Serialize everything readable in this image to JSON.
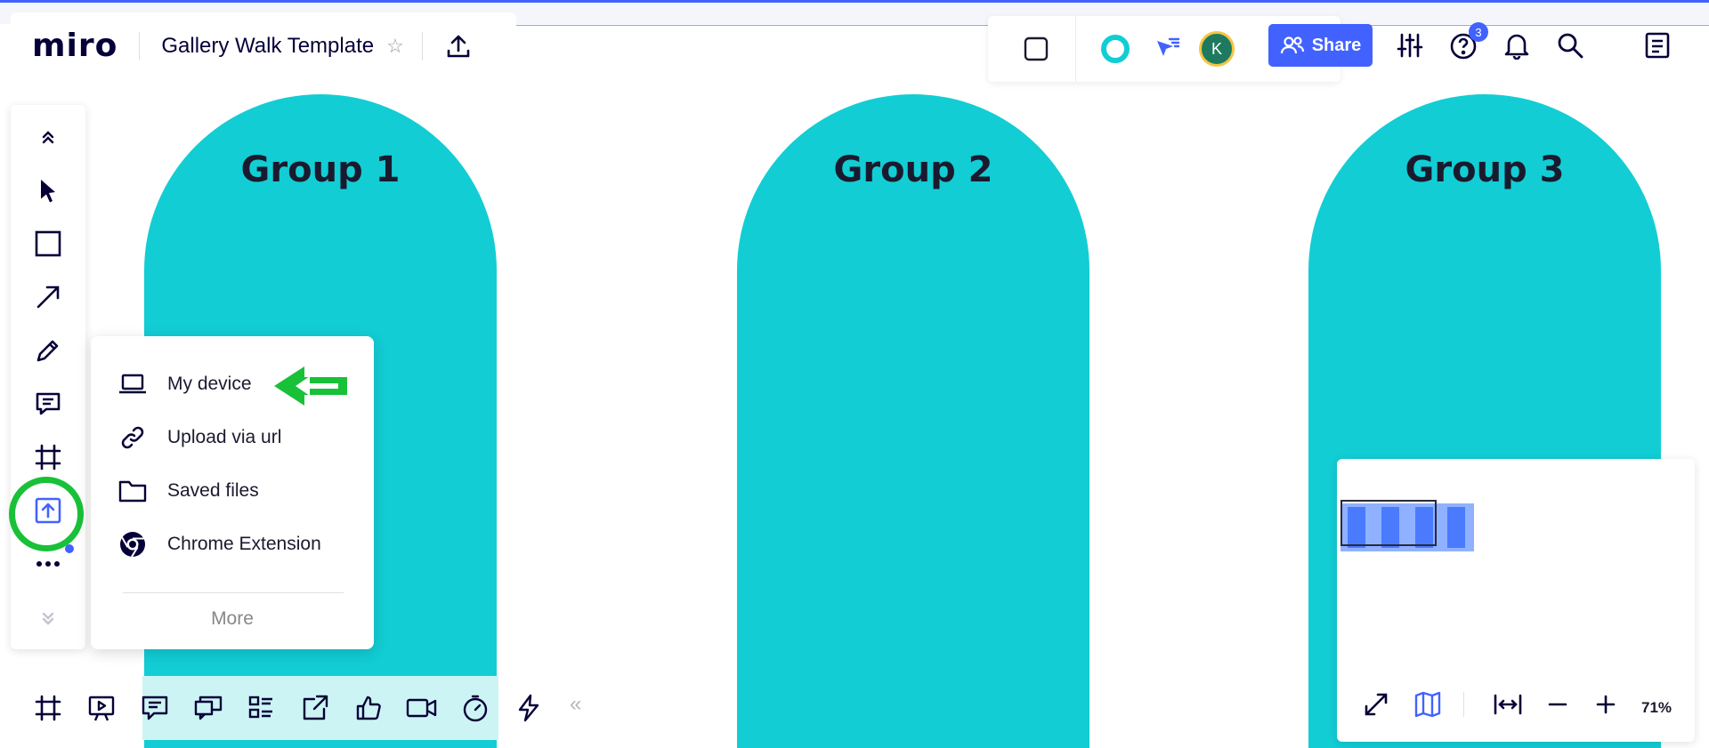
{
  "app": {
    "logo": "miro",
    "board_title": "Gallery Walk Template"
  },
  "groups": [
    {
      "title": "Group 1"
    },
    {
      "title": "Group 2"
    },
    {
      "title": "Group 3"
    }
  ],
  "header_right": {
    "avatar_initial": "K",
    "share_label": "Share",
    "help_badge_count": "3"
  },
  "left_toolbar": {
    "tools": [
      "collapse-up",
      "select",
      "shape",
      "connection-line",
      "pen",
      "comment",
      "frame",
      "upload",
      "more",
      "collapse-down"
    ],
    "active_tool": "upload"
  },
  "upload_menu": {
    "items": [
      {
        "label": "My device",
        "icon": "laptop-icon"
      },
      {
        "label": "Upload via url",
        "icon": "link-icon"
      },
      {
        "label": "Saved files",
        "icon": "folder-icon"
      },
      {
        "label": "Chrome Extension",
        "icon": "chrome-icon"
      }
    ],
    "more_label": "More"
  },
  "bottom_toolbar": {
    "tools": [
      "frames",
      "presentation",
      "comments",
      "cards",
      "kanban",
      "export",
      "voting",
      "video",
      "timer",
      "lightning"
    ],
    "collapse_glyph": "«"
  },
  "minimap": {
    "zoom": "71%"
  },
  "colors": {
    "group_fill": "#12cdd4",
    "accent": "#4262ff",
    "highlight_green": "#18c138"
  }
}
